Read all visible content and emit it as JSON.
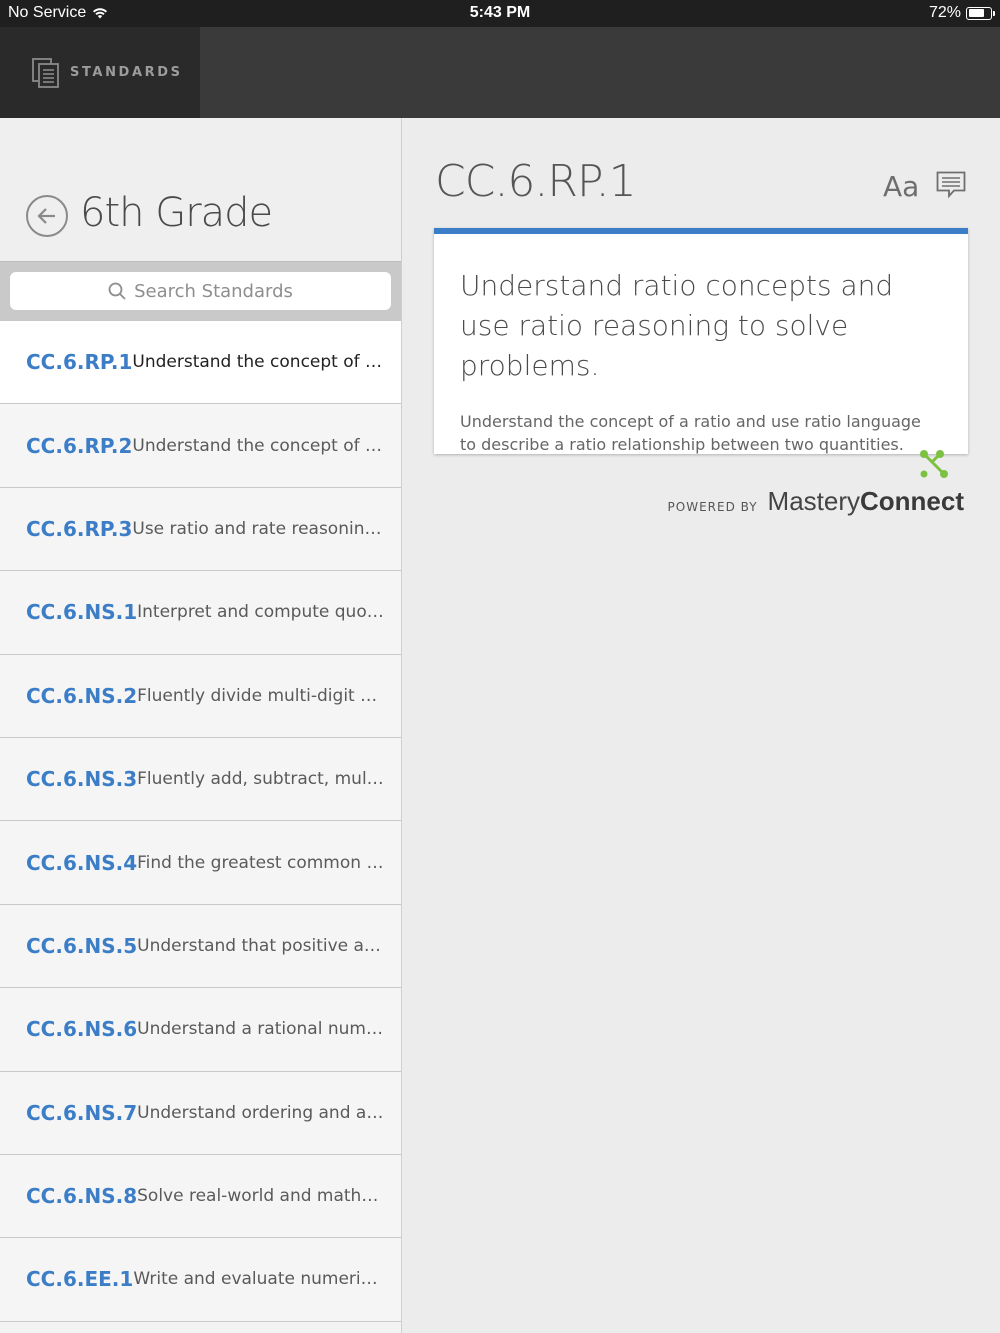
{
  "status_bar": {
    "carrier": "No Service",
    "time": "5:43 PM",
    "battery": "72%",
    "battery_level": 0.72
  },
  "nav": {
    "tab_label": "STANDARDS"
  },
  "sidebar": {
    "grade_title": "6th Grade",
    "search_placeholder": "Search Standards",
    "items": [
      {
        "code": "CC.6.RP.1",
        "desc": "Understand the concept of a r..."
      },
      {
        "code": "CC.6.RP.2",
        "desc": "Understand the concept of a u..."
      },
      {
        "code": "CC.6.RP.3",
        "desc": "Use ratio and rate reasoning t..."
      },
      {
        "code": "CC.6.NS.1",
        "desc": "Interpret and compute quotie..."
      },
      {
        "code": "CC.6.NS.2",
        "desc": "Fluently divide multi-digit num..."
      },
      {
        "code": "CC.6.NS.3",
        "desc": "Fluently add, subtract, multiply,..."
      },
      {
        "code": "CC.6.NS.4",
        "desc": "Find the greatest common fact..."
      },
      {
        "code": "CC.6.NS.5",
        "desc": "Understand that positive and..."
      },
      {
        "code": "CC.6.NS.6",
        "desc": "Understand a rational number..."
      },
      {
        "code": "CC.6.NS.7",
        "desc": "Understand ordering and abso..."
      },
      {
        "code": "CC.6.NS.8",
        "desc": "Solve real-world and mathema..."
      },
      {
        "code": "CC.6.EE.1",
        "desc": "Write and evaluate numerical e..."
      }
    ]
  },
  "detail": {
    "title": "CC.6.RP.1",
    "font_button": "Aa",
    "heading": "Understand ratio concepts and use ratio reasoning to solve problems.",
    "body": "Understand the concept of a ratio and use ratio language to describe a ratio relationship between two quantities.",
    "powered_by": "POWERED BY",
    "brand_light": "Mastery",
    "brand_bold": "Connect"
  },
  "colors": {
    "accent": "#3b7dc6",
    "brand_green": "#7dc143"
  }
}
